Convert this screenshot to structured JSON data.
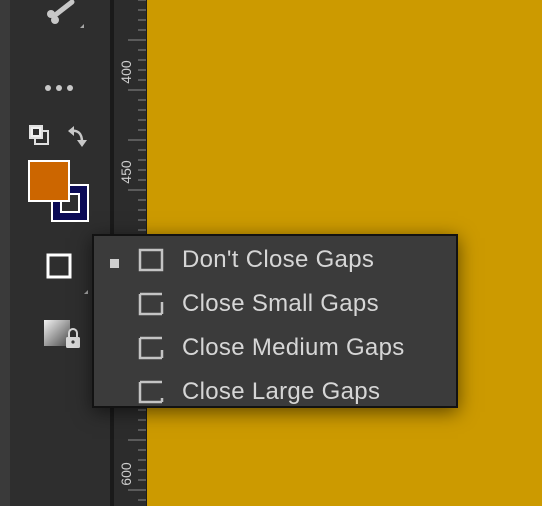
{
  "ruler": {
    "labels": [
      "400",
      "450",
      "600"
    ]
  },
  "toolbar": {
    "icons": [
      "bone-tool-icon",
      "more-tools-icon",
      "default-colors-icon",
      "swap-colors-icon",
      "fill-color-swatch",
      "stroke-color-swatch",
      "frame-icon",
      "locked-gradient-icon"
    ],
    "fill_color": "#cc6600",
    "stroke_color": "#0a0a55"
  },
  "canvas": {
    "background": "#cc9a00"
  },
  "menu": {
    "items": [
      {
        "label": "Don't Close Gaps",
        "selected": true,
        "icon": "no-gap-icon"
      },
      {
        "label": "Close Small Gaps",
        "selected": false,
        "icon": "small-gap-icon"
      },
      {
        "label": "Close Medium Gaps",
        "selected": false,
        "icon": "medium-gap-icon"
      },
      {
        "label": "Close Large Gaps",
        "selected": false,
        "icon": "large-gap-icon"
      }
    ]
  }
}
